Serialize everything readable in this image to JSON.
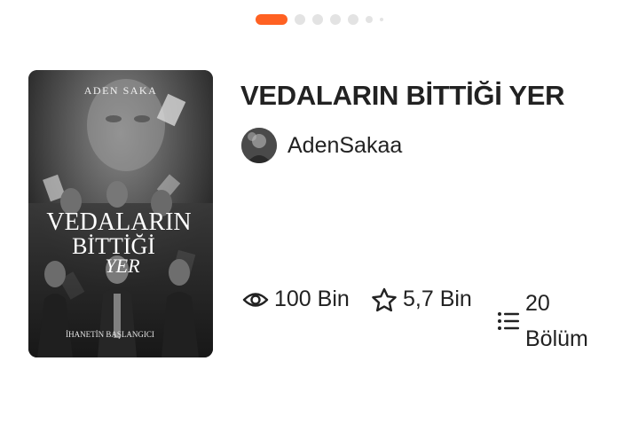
{
  "carousel": {
    "dots": [
      "active",
      "normal",
      "normal",
      "normal",
      "normal",
      "small",
      "tiny"
    ]
  },
  "book": {
    "title": "VEDALARIN BİTTİĞİ YER",
    "cover": {
      "author_line": "ADEN SAKA",
      "title_line1": "VEDALARIN",
      "title_line2": "BİTTİĞİ",
      "title_line3": "YER",
      "subtitle": "İHANETİN BAŞLANGICI"
    },
    "author": "AdenSakaa"
  },
  "stats": {
    "views": "100 Bin",
    "votes": "5,7 Bin",
    "parts_count": "20",
    "parts_label": "Bölüm"
  },
  "colors": {
    "accent": "#ff6122",
    "text": "#222222",
    "dot_inactive": "#e3e3e3"
  },
  "icons": {
    "views": "eye-icon",
    "votes": "star-icon",
    "parts": "list-icon"
  }
}
